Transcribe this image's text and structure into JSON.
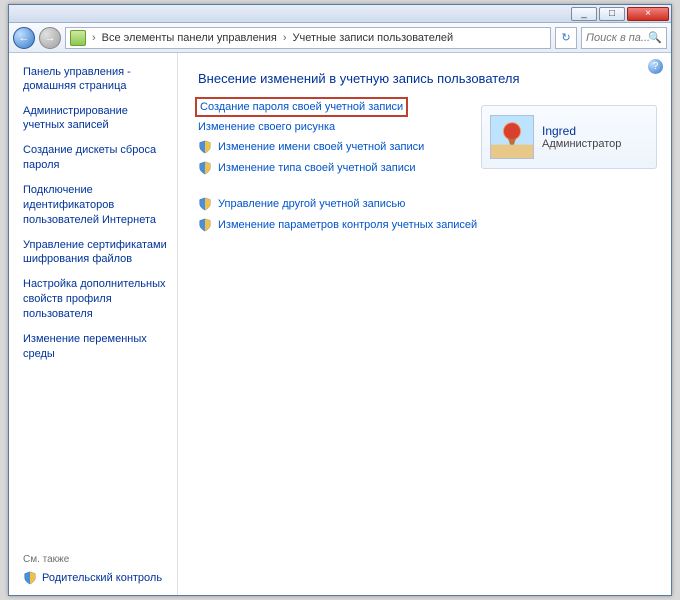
{
  "window": {
    "min_label": "_",
    "max_label": "□",
    "close_label": "×"
  },
  "nav": {
    "breadcrumb1": "Все элементы панели управления",
    "breadcrumb2": "Учетные записи пользователей",
    "chev": "›",
    "refresh_glyph": "↻",
    "search_placeholder": "Поиск в па...",
    "back_glyph": "←",
    "fwd_glyph": "→"
  },
  "sidebar": {
    "home": "Панель управления - домашняя страница",
    "items": [
      "Администрирование учетных записей",
      "Создание дискеты сброса пароля",
      "Подключение идентификаторов пользователей Интернета",
      "Управление сертификатами шифрования файлов",
      "Настройка дополнительных свойств профиля пользователя",
      "Изменение переменных среды"
    ],
    "see_also": "См. также",
    "parental": "Родительский контроль"
  },
  "main": {
    "heading": "Внесение изменений в учетную запись пользователя",
    "links_top": [
      "Создание пароля своей учетной записи",
      "Изменение своего рисунка",
      "Изменение имени своей учетной записи",
      "Изменение типа своей учетной записи"
    ],
    "links_bottom": [
      "Управление другой учетной записью",
      "Изменение параметров контроля учетных записей"
    ],
    "help_glyph": "?"
  },
  "user": {
    "name": "Ingred",
    "role": "Администратор"
  }
}
